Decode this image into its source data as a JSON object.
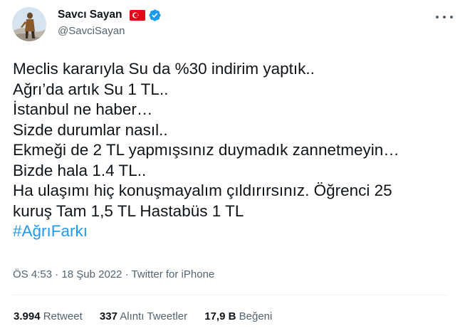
{
  "user": {
    "display_name": "Savcı Sayan",
    "handle": "@SavciSayan"
  },
  "colors": {
    "accent": "#1d9bf0",
    "flag": "#e30a17",
    "muted": "#536471"
  },
  "icons": [
    "turkey-flag-icon",
    "verified-badge-icon",
    "more-options-icon"
  ],
  "tweet": {
    "lines": [
      "Meclis kararıyla Su da %30 indirim yaptık..",
      "Ağrı’da artık Su 1 TL..",
      "İstanbul ne haber…",
      "Sizde durumlar nasıl..",
      "Ekmeği de 2 TL yapmışsınız duymadık zannetmeyin…",
      "Bizde hala 1.4 TL..",
      "Ha ulaşımı hiç konuşmayalım çıldırırsınız. Öğrenci 25",
      "kuruş Tam 1,5 TL Hastabüs 1 TL"
    ],
    "hashtag": "#AğrıFarkı"
  },
  "meta": {
    "time": "ÖS 4:53",
    "separator": " · ",
    "date": "18 Şub 2022",
    "source": "Twitter for iPhone"
  },
  "stats": {
    "retweets_count": "3.994",
    "retweets_label": "Retweet",
    "quotes_count": "337",
    "quotes_label": "Alıntı Tweetler",
    "likes_count": "17,9 B",
    "likes_label": "Beğeni"
  }
}
